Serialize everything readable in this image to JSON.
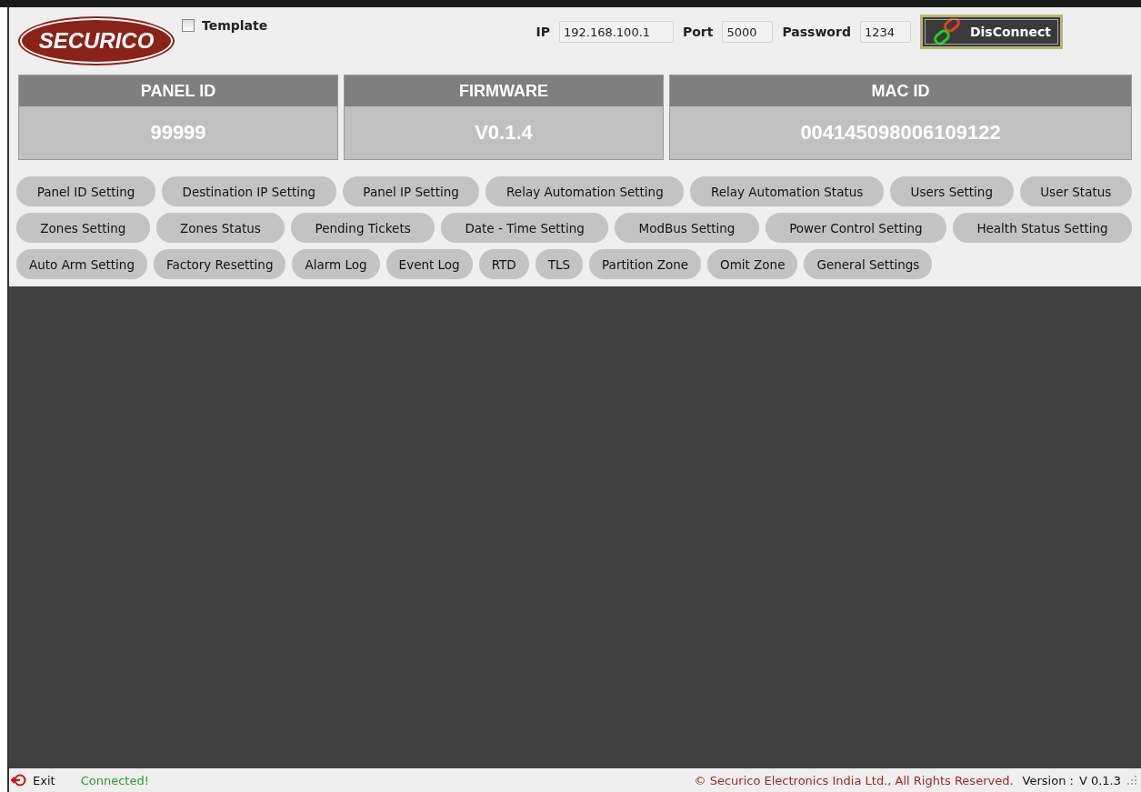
{
  "logo": {
    "text": "SECURICO"
  },
  "template": {
    "label": "Template",
    "checked": false
  },
  "connection": {
    "ip_label": "IP",
    "ip": "192.168.100.1",
    "port_label": "Port",
    "port": "5000",
    "password_label": "Password",
    "password": "1234",
    "button": "DisConnect"
  },
  "info_cards": [
    {
      "title": "PANEL ID",
      "value": "99999"
    },
    {
      "title": "FIRMWARE",
      "value": "V0.1.4"
    },
    {
      "title": "MAC ID",
      "value": "004145098006109122"
    }
  ],
  "menu_rows": [
    [
      "Panel ID Setting",
      "Destination IP Setting",
      "Panel IP Setting",
      "Relay Automation Setting",
      "Relay Automation Status",
      "Users Setting",
      "User Status"
    ],
    [
      "Zones Setting",
      "Zones Status",
      "Pending Tickets",
      "Date - Time Setting",
      "ModBus Setting",
      "Power Control Setting",
      "Health Status Setting"
    ],
    [
      "Auto Arm Setting",
      "Factory Resetting",
      "Alarm Log",
      "Event Log",
      "RTD",
      "TLS",
      "Partition Zone",
      "Omit Zone",
      "General Settings"
    ]
  ],
  "status_bar": {
    "exit": "Exit",
    "status": "Connected!",
    "copyright": "© Securico Electronics India Ltd., All Rights Reserved.",
    "version_label": "Version :",
    "version": "V 0.1.3"
  }
}
